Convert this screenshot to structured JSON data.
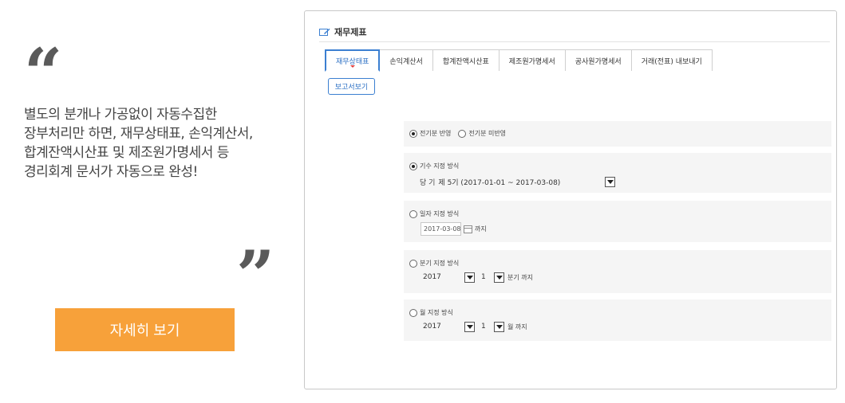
{
  "promo": {
    "open_quote": "“",
    "close_quote": "”",
    "lines": [
      "별도의 분개나 가공없이 자동수집한",
      "장부처리만 하면, 재무상태표, 손익계산서,",
      "합계잔액시산표 및 제조원가명세서 등",
      "경리회계 문서가 자동으로 완성!"
    ],
    "detail_button": "자세히 보기"
  },
  "panel": {
    "title": "재무제표",
    "tabs": [
      {
        "label": "재무상태표",
        "active": true
      },
      {
        "label": "손익계산서",
        "active": false
      },
      {
        "label": "합계잔액시산표",
        "active": false
      },
      {
        "label": "제조원가명세서",
        "active": false
      },
      {
        "label": "공사원가명세서",
        "active": false
      },
      {
        "label": "거래(전표) 내보내기",
        "active": false
      }
    ],
    "report_button": "보고서보기",
    "prior_period": {
      "reflect_label": "전기분 반영",
      "not_reflect_label": "전기분 미반영",
      "selected": "reflect"
    },
    "fiscal_method": {
      "label": "기수 지정 방식",
      "prefix": "당 기",
      "value": "제 5기 (2017-01-01 ~ 2017-03-08)",
      "selected": true
    },
    "date_method": {
      "label": "일자 지정 방식",
      "date": "2017-03-08",
      "suffix": "까지",
      "selected": false
    },
    "quarter_method": {
      "label": "분기 지정 방식",
      "year": "2017",
      "quarter": "1",
      "suffix": "분기 까지",
      "selected": false
    },
    "month_method": {
      "label": "월 지정 방식",
      "year": "2017",
      "month": "1",
      "suffix": "월 까지",
      "selected": false
    }
  },
  "colors": {
    "accent_orange": "#f7a13a",
    "tab_blue": "#3b7fd1"
  }
}
